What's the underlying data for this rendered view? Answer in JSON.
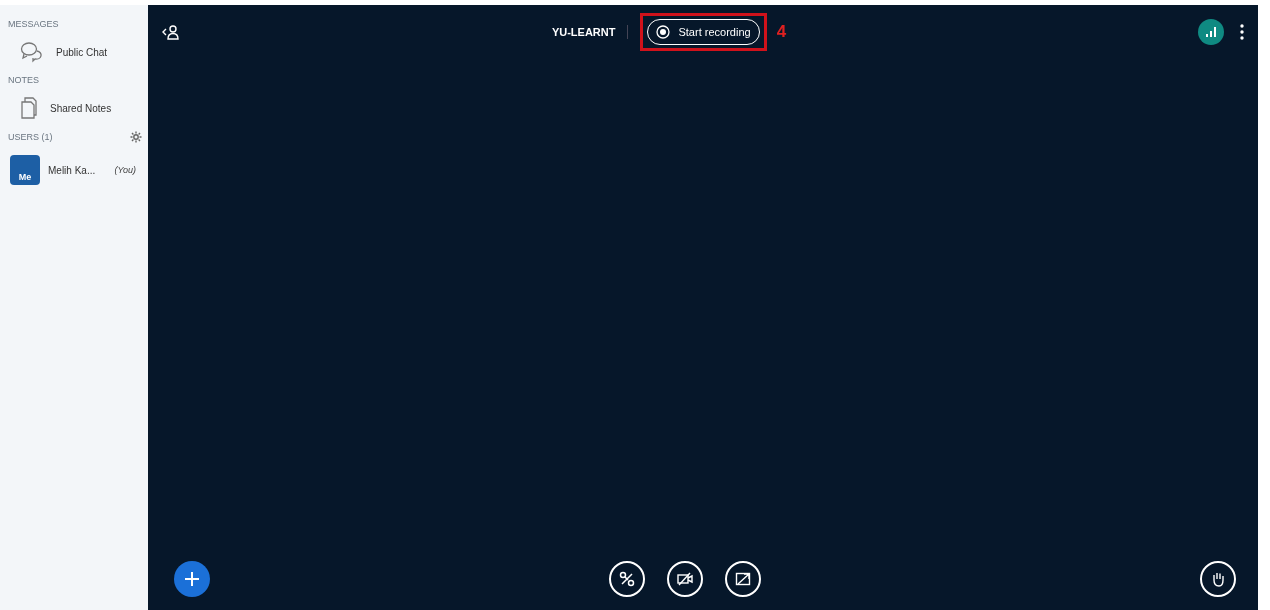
{
  "sidebar": {
    "sections": [
      {
        "kind": "messages",
        "title": "MESSAGES",
        "items": [
          {
            "kind": "chat",
            "label": "Public Chat"
          }
        ]
      },
      {
        "kind": "notes",
        "title": "NOTES",
        "items": [
          {
            "kind": "notes",
            "label": "Shared Notes"
          }
        ]
      },
      {
        "kind": "users",
        "title": "USERS (1)",
        "items": [
          {
            "kind": "user",
            "avatar": "Me",
            "label": "Melih Ka...",
            "suffix": "(You)"
          }
        ]
      }
    ]
  },
  "topbar": {
    "meeting_title": "YU-LEARNT",
    "record_button": "Start recording",
    "annotation": "4"
  }
}
